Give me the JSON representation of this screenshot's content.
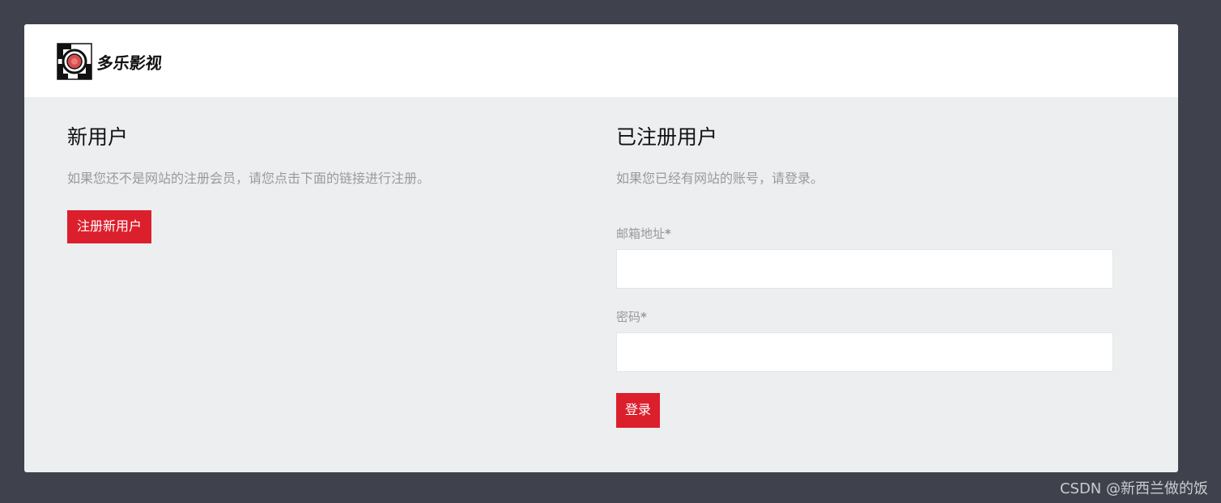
{
  "brand": {
    "name": "多乐影视",
    "logo_icon": "film-reel-logo-icon",
    "accent_color": "#dc1f2c"
  },
  "new_user": {
    "title": "新用户",
    "description": "如果您还不是网站的注册会员，请您点击下面的链接进行注册。",
    "register_button": "注册新用户"
  },
  "registered_user": {
    "title": "已注册用户",
    "description": "如果您已经有网站的账号，请登录。",
    "email_label": "邮箱地址",
    "email_required": "*",
    "email_value": "",
    "password_label": "密码",
    "password_required": "*",
    "password_value": "",
    "login_button": "登录"
  },
  "watermark": "CSDN @新西兰做的饭"
}
